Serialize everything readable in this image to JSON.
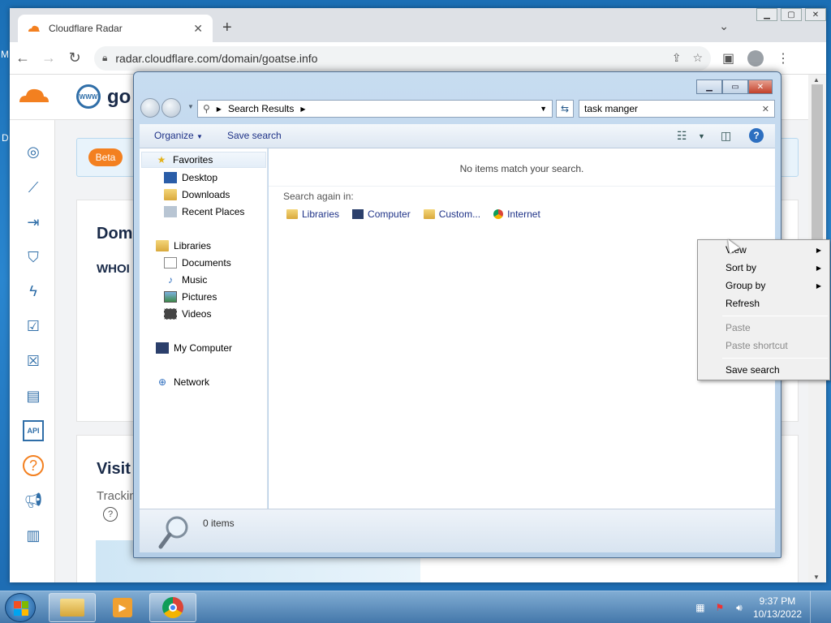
{
  "desktop": {
    "frag_left_top": "M",
    "frag_left_mid": "D"
  },
  "browser": {
    "tab_title": "Cloudflare Radar",
    "tab_close": "✕",
    "new_tab": "+",
    "url": "radar.cloudflare.com/domain/goatse.info",
    "page": {
      "site_title": "go",
      "www_label": "WWW",
      "beta_badge": "Beta",
      "card1_title": "Dom",
      "card1_whois": "WHOI",
      "card2_title": "Visit",
      "card2_tracking": "Trackin",
      "api_label": "API",
      "help_label": "?"
    }
  },
  "explorer": {
    "address_text": "Search Results",
    "search_value": "task manger",
    "commands": {
      "organize": "Organize",
      "save_search": "Save search"
    },
    "nav": {
      "favorites": "Favorites",
      "desktop": "Desktop",
      "downloads": "Downloads",
      "recent_places": "Recent Places",
      "libraries": "Libraries",
      "documents": "Documents",
      "music": "Music",
      "pictures": "Pictures",
      "videos": "Videos",
      "my_computer": "My Computer",
      "network": "Network"
    },
    "content": {
      "no_items": "No items match your search.",
      "search_again_label": "Search again in:",
      "search_again": [
        "Libraries",
        "Computer",
        "Custom...",
        "Internet"
      ]
    },
    "details": {
      "count": "0 items"
    }
  },
  "context_menu": {
    "items": [
      {
        "label": "View",
        "submenu": true,
        "enabled": true
      },
      {
        "label": "Sort by",
        "submenu": true,
        "enabled": true
      },
      {
        "label": "Group by",
        "submenu": true,
        "enabled": true
      },
      {
        "label": "Refresh",
        "submenu": false,
        "enabled": true
      },
      {
        "label": "Paste",
        "submenu": false,
        "enabled": false
      },
      {
        "label": "Paste shortcut",
        "submenu": false,
        "enabled": false
      },
      {
        "label": "Save search",
        "submenu": false,
        "enabled": true
      }
    ]
  },
  "taskbar": {
    "time": "9:37 PM",
    "date": "10/13/2022"
  },
  "colors": {
    "cloudflare_orange": "#f38020",
    "radar_blue": "#2f6ea8",
    "win_link": "#1e3287"
  }
}
